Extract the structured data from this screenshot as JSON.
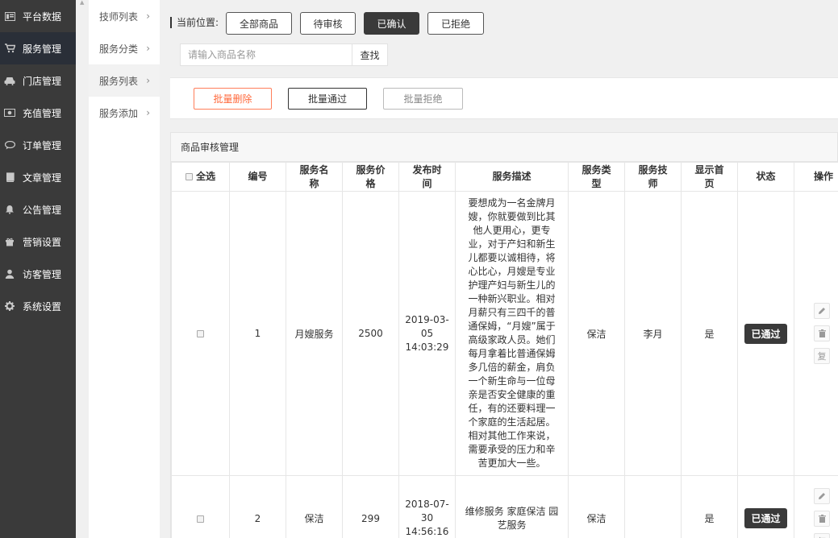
{
  "nav": {
    "items": [
      {
        "label": "平台数据",
        "icon": "dashboard-icon"
      },
      {
        "label": "服务管理",
        "icon": "cart-icon"
      },
      {
        "label": "门店管理",
        "icon": "car-icon"
      },
      {
        "label": "充值管理",
        "icon": "money-icon"
      },
      {
        "label": "订单管理",
        "icon": "comment-icon"
      },
      {
        "label": "文章管理",
        "icon": "book-icon"
      },
      {
        "label": "公告管理",
        "icon": "bell-icon"
      },
      {
        "label": "营销设置",
        "icon": "gift-icon"
      },
      {
        "label": "访客管理",
        "icon": "user-icon"
      },
      {
        "label": "系统设置",
        "icon": "gear-icon"
      }
    ],
    "active_index": 1
  },
  "submenu": {
    "items": [
      {
        "label": "技师列表",
        "arrow": "›"
      },
      {
        "label": "服务分类",
        "arrow": "›"
      },
      {
        "label": "服务列表",
        "arrow": "›"
      },
      {
        "label": "服务添加",
        "arrow": "›"
      }
    ],
    "active_index": 2
  },
  "location": {
    "label": "当前位置:",
    "filters": [
      "全部商品",
      "待审核",
      "已确认",
      "已拒绝"
    ],
    "active_filter": "已确认"
  },
  "search": {
    "placeholder": "请输入商品名称",
    "value": "",
    "button": "查找"
  },
  "batch": {
    "delete": "批量删除",
    "approve": "批量通过",
    "reject": "批量拒绝"
  },
  "panel": {
    "title": "商品审核管理",
    "select_all": "全选",
    "columns": [
      "编号",
      "服务名称",
      "服务价格",
      "发布时间",
      "服务描述",
      "服务类型",
      "服务技师",
      "显示首页",
      "状态",
      "操作"
    ],
    "rows": [
      {
        "id": "1",
        "name": "月嫂服务",
        "price": "2500",
        "time_date": "2019-03-05",
        "time_clock": "14:03:29",
        "description": "要想成为一名金牌月嫂，你就要做到比其他人更用心，更专业，对于产妇和新生儿都要以诚相待，将心比心，月嫂是专业护理产妇与新生儿的一种新兴职业。相对月薪只有三四千的普通保姆，“月嫂”属于高级家政人员。她们每月拿着比普通保姆多几倍的薪金，肩负一个新生命与一位母亲是否安全健康的重任，有的还要料理一个家庭的生活起居。相对其他工作来说，需要承受的压力和辛苦更加大一些。",
        "type": "保洁",
        "technician": "李月",
        "show_home": "是",
        "status": "已通过"
      },
      {
        "id": "2",
        "name": "保洁",
        "price": "299",
        "time_date": "2018-07-30",
        "time_clock": "14:56:16",
        "description": "维修服务 家庭保洁 园艺服务",
        "type": "保洁",
        "technician": "",
        "show_home": "是",
        "status": "已通过"
      }
    ],
    "op_icons": [
      "edit-icon",
      "trash-icon",
      "copy-icon"
    ],
    "op_copy_label": "复"
  }
}
